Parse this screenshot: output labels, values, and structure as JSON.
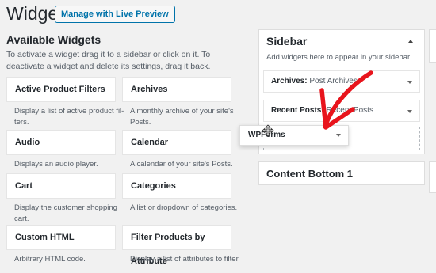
{
  "header": {
    "title": "Widgets",
    "live_preview_label": "Manage with Live Preview"
  },
  "available": {
    "title": "Available Widgets",
    "description": "To activate a widget drag it to a sidebar or click on it. To deactivate a widget and delete its settings, drag it back.",
    "widgets": [
      {
        "name": "Active Product Filters",
        "desc": "Display a list of active product fil-ters."
      },
      {
        "name": "Archives",
        "desc": "A monthly archive of your site's Posts."
      },
      {
        "name": "Audio",
        "desc": "Displays an audio player."
      },
      {
        "name": "Calendar",
        "desc": "A calendar of your site's Posts."
      },
      {
        "name": "Cart",
        "desc": "Display the customer shopping cart."
      },
      {
        "name": "Categories",
        "desc": "A list or dropdown of categories."
      },
      {
        "name": "Custom HTML",
        "desc": "Arbitrary HTML code."
      },
      {
        "name": "Filter Products by Attribute",
        "desc": "Display a list of attributes to filter"
      }
    ]
  },
  "sidebar": {
    "title": "Sidebar",
    "description": "Add widgets here to appear in your sidebar.",
    "widgets": [
      {
        "title": "Archives:",
        "subtitle": "Post Archives"
      },
      {
        "title": "Recent Posts:",
        "subtitle": "Recent Posts"
      }
    ]
  },
  "dragging_widget": {
    "name": "WPForms"
  },
  "content_bottom": {
    "title": "Content Bottom 1"
  },
  "colors": {
    "accent": "#0073aa",
    "annotation_arrow": "#e8141c",
    "background": "#f1f1f1"
  },
  "icons": [
    "caret-up-icon",
    "caret-down-icon",
    "move-icon"
  ]
}
